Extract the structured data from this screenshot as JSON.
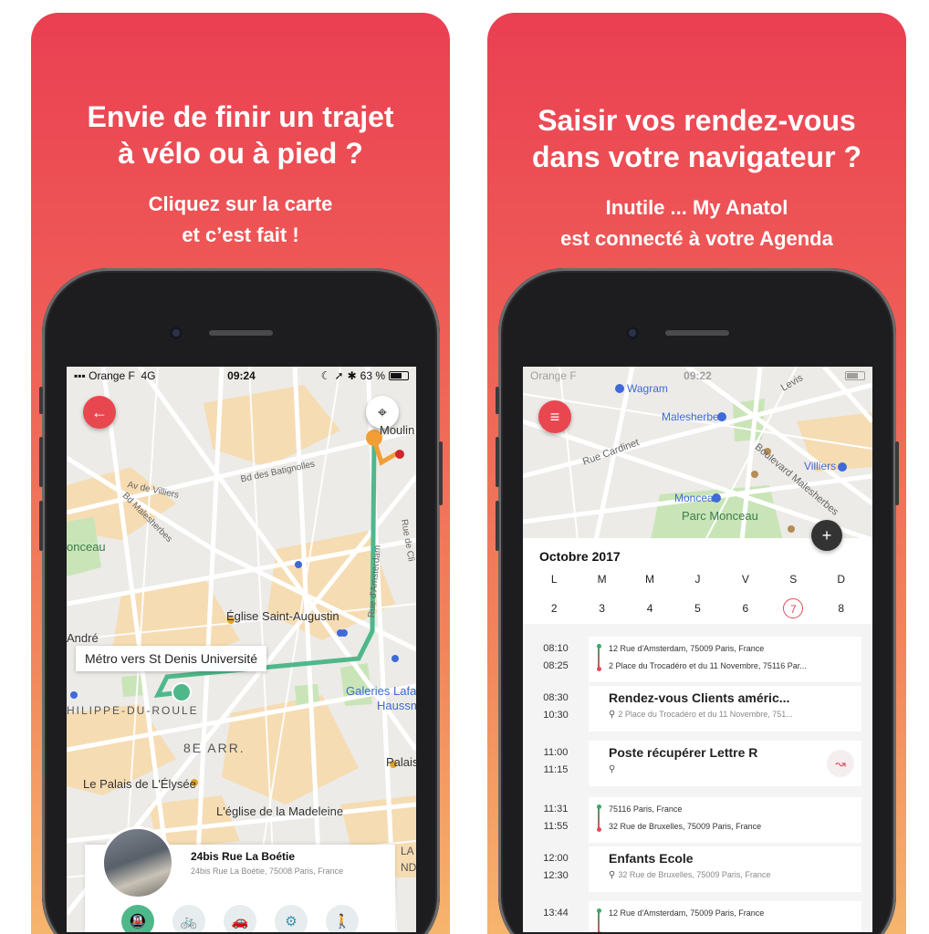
{
  "panels": {
    "left": {
      "headline": [
        "Envie de finir un trajet",
        "à vélo ou à pied ?"
      ],
      "subline": [
        "Cliquez sur la carte",
        "et c’est fait !"
      ],
      "status": {
        "carrier": "Orange F",
        "network": "4G",
        "time": "09:24",
        "battery": "63 %"
      },
      "map": {
        "places": [
          "Moulin",
          "Bd des Batignolles",
          "Av de Villiers",
          "Bd Malesherbes",
          "onceau",
          "Rue d'Amsterdam",
          "Rue de Cli",
          "Église Saint-Augustin",
          "André",
          "HILIPPE-DU-ROULE",
          "Galeries Lafay",
          "Haussm",
          "8E ARR.",
          "Palais",
          "Le Palais de L'Élysée",
          "L'église de la Madeleine",
          "LA",
          "ND"
        ],
        "callout": "Métro vers St Denis Université"
      },
      "address": {
        "title": "24bis Rue La Boétie",
        "subtitle": "24bis Rue La Boétie, 75008 Paris, France"
      },
      "modes": [
        "metro",
        "bike",
        "car",
        "bike-share",
        "walk"
      ],
      "accent": "#e9474f",
      "route_color": "#4fb88b"
    },
    "right": {
      "headline": [
        "Saisir vos rendez-vous",
        "dans votre navigateur ?"
      ],
      "subline": [
        "Inutile ... My Anatol",
        "est connecté à votre Agenda"
      ],
      "status": {
        "carrier": "Orange F",
        "time": "09:22"
      },
      "map": {
        "places": [
          "Wagram",
          "Malesherbes",
          "Rue Cardinet",
          "Boulevard Malesherbes",
          "Villiers",
          "Monceau",
          "Parc Monceau",
          "Levis"
        ]
      },
      "agenda": {
        "month": "Octobre 2017",
        "days": [
          {
            "name": "L",
            "num": "2"
          },
          {
            "name": "M",
            "num": "3"
          },
          {
            "name": "M",
            "num": "4"
          },
          {
            "name": "J",
            "num": "5"
          },
          {
            "name": "V",
            "num": "6"
          },
          {
            "name": "S",
            "num": "7",
            "today": true
          },
          {
            "name": "D",
            "num": "8"
          }
        ],
        "events": [
          {
            "kind": "route",
            "start": "08:10",
            "end": "08:25",
            "from": "12 Rue d'Amsterdam, 75009 Paris, France",
            "to": "2 Place du Trocadéro et du 11 Novembre, 75116 Par..."
          },
          {
            "kind": "meeting",
            "start": "08:30",
            "end": "10:30",
            "title": "Rendez-vous Clients améric...",
            "place": "2 Place du Trocadéro et du 11 Novembre, 751..."
          },
          {
            "kind": "meeting",
            "start": "11:00",
            "end": "11:15",
            "title": "Poste récupérer Lettre R",
            "place": "",
            "route_button": true
          },
          {
            "kind": "route",
            "start": "11:31",
            "end": "11:55",
            "from": "75116 Paris, France",
            "to": "32 Rue de Bruxelles, 75009 Paris, France"
          },
          {
            "kind": "meeting",
            "start": "12:00",
            "end": "12:30",
            "title": "Enfants Ecole",
            "place": "32 Rue de Bruxelles, 75009 Paris, France"
          },
          {
            "kind": "route",
            "start": "13:44",
            "end": "",
            "from": "12 Rue d'Amsterdam, 75009 Paris, France",
            "to": ""
          }
        ]
      },
      "accent": "#e9474f"
    }
  }
}
